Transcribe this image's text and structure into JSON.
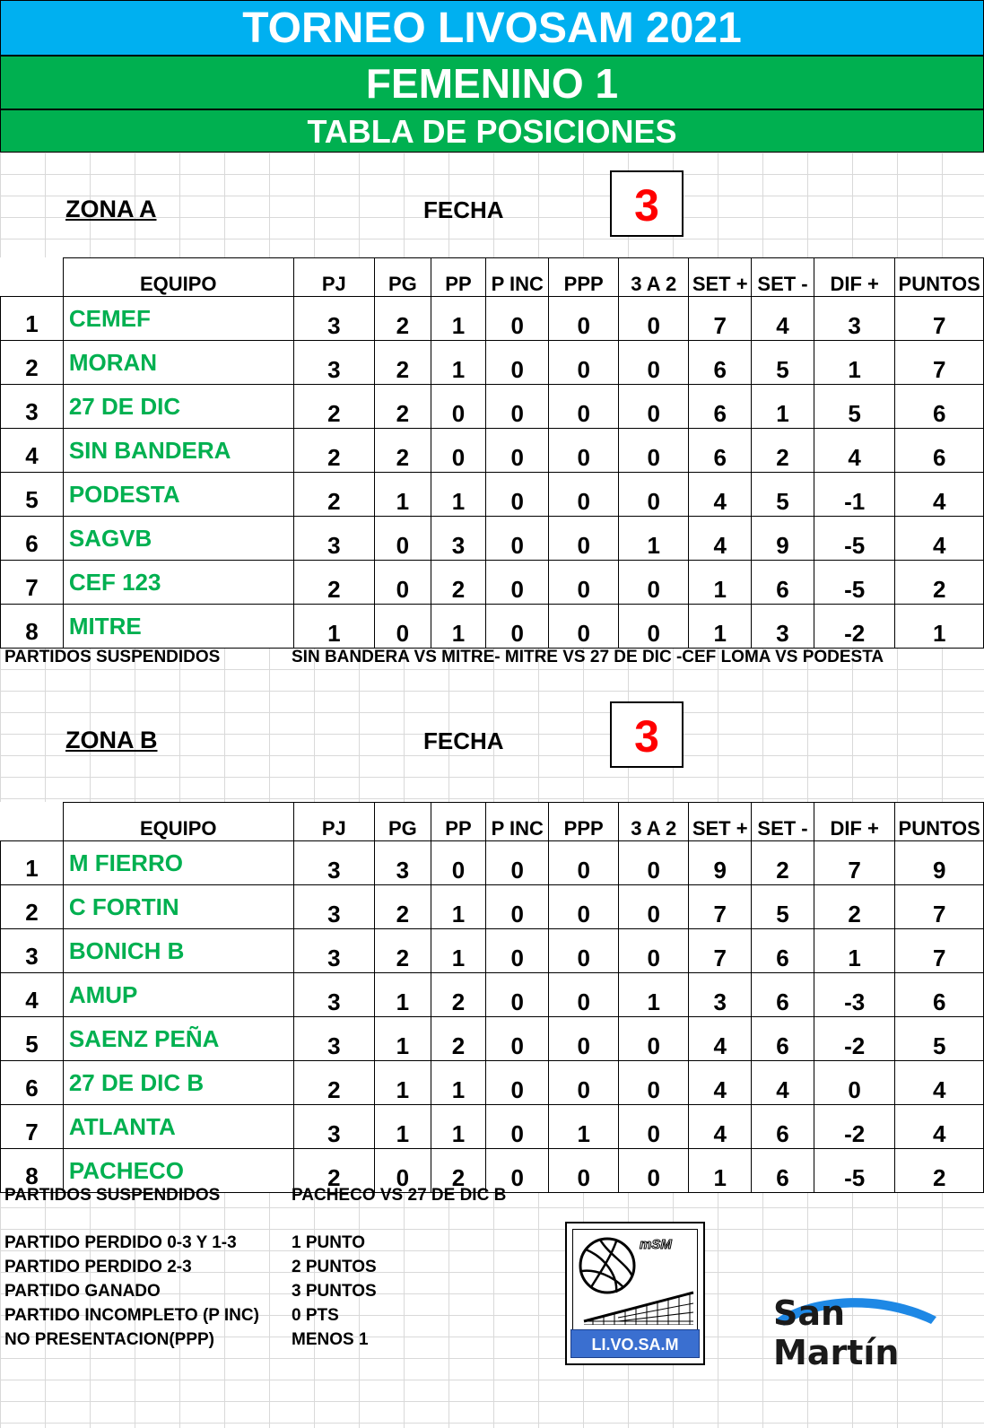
{
  "header": {
    "title": "TORNEO LIVOSAM 2021",
    "category": "FEMENINO 1",
    "subtitle": "TABLA DE POSICIONES"
  },
  "columns": [
    "EQUIPO",
    "PJ",
    "PG",
    "PP",
    "P INC",
    "PPP",
    "3 A 2",
    "SET +",
    "SET -",
    "DIF +",
    "PUNTOS"
  ],
  "fecha_label": "FECHA",
  "suspended_label": "PARTIDOS SUSPENDIDOS",
  "zones": [
    {
      "name": "ZONA A",
      "fecha": "3",
      "rows": [
        {
          "rank": "1",
          "team": "CEMEF",
          "pj": "3",
          "pg": "2",
          "pp": "1",
          "pinc": "0",
          "ppp": "0",
          "tres_a_dos": "0",
          "set_plus": "7",
          "set_minus": "4",
          "dif": "3",
          "puntos": "7"
        },
        {
          "rank": "2",
          "team": "MORAN",
          "pj": "3",
          "pg": "2",
          "pp": "1",
          "pinc": "0",
          "ppp": "0",
          "tres_a_dos": "0",
          "set_plus": "6",
          "set_minus": "5",
          "dif": "1",
          "puntos": "7"
        },
        {
          "rank": "3",
          "team": "27 DE DIC",
          "pj": "2",
          "pg": "2",
          "pp": "0",
          "pinc": "0",
          "ppp": "0",
          "tres_a_dos": "0",
          "set_plus": "6",
          "set_minus": "1",
          "dif": "5",
          "puntos": "6"
        },
        {
          "rank": "4",
          "team": "SIN BANDERA",
          "pj": "2",
          "pg": "2",
          "pp": "0",
          "pinc": "0",
          "ppp": "0",
          "tres_a_dos": "0",
          "set_plus": "6",
          "set_minus": "2",
          "dif": "4",
          "puntos": "6"
        },
        {
          "rank": "5",
          "team": "PODESTA",
          "pj": "2",
          "pg": "1",
          "pp": "1",
          "pinc": "0",
          "ppp": "0",
          "tres_a_dos": "0",
          "set_plus": "4",
          "set_minus": "5",
          "dif": "-1",
          "puntos": "4"
        },
        {
          "rank": "6",
          "team": "SAGVB",
          "pj": "3",
          "pg": "0",
          "pp": "3",
          "pinc": "0",
          "ppp": "0",
          "tres_a_dos": "1",
          "set_plus": "4",
          "set_minus": "9",
          "dif": "-5",
          "puntos": "4"
        },
        {
          "rank": "7",
          "team": "CEF 123",
          "pj": "2",
          "pg": "0",
          "pp": "2",
          "pinc": "0",
          "ppp": "0",
          "tres_a_dos": "0",
          "set_plus": "1",
          "set_minus": "6",
          "dif": "-5",
          "puntos": "2"
        },
        {
          "rank": "8",
          "team": "MITRE",
          "pj": "1",
          "pg": "0",
          "pp": "1",
          "pinc": "0",
          "ppp": "0",
          "tres_a_dos": "0",
          "set_plus": "1",
          "set_minus": "3",
          "dif": "-2",
          "puntos": "1"
        }
      ],
      "suspended": "SIN BANDERA VS MITRE- MITRE VS 27 DE DIC -CEF LOMA VS PODESTA"
    },
    {
      "name": "ZONA B",
      "fecha": "3",
      "rows": [
        {
          "rank": "1",
          "team": "M FIERRO",
          "pj": "3",
          "pg": "3",
          "pp": "0",
          "pinc": "0",
          "ppp": "0",
          "tres_a_dos": "0",
          "set_plus": "9",
          "set_minus": "2",
          "dif": "7",
          "puntos": "9"
        },
        {
          "rank": "2",
          "team": "C FORTIN",
          "pj": "3",
          "pg": "2",
          "pp": "1",
          "pinc": "0",
          "ppp": "0",
          "tres_a_dos": "0",
          "set_plus": "7",
          "set_minus": "5",
          "dif": "2",
          "puntos": "7"
        },
        {
          "rank": "3",
          "team": "BONICH B",
          "pj": "3",
          "pg": "2",
          "pp": "1",
          "pinc": "0",
          "ppp": "0",
          "tres_a_dos": "0",
          "set_plus": "7",
          "set_minus": "6",
          "dif": "1",
          "puntos": "7"
        },
        {
          "rank": "4",
          "team": "AMUP",
          "pj": "3",
          "pg": "1",
          "pp": "2",
          "pinc": "0",
          "ppp": "0",
          "tres_a_dos": "1",
          "set_plus": "3",
          "set_minus": "6",
          "dif": "-3",
          "puntos": "6"
        },
        {
          "rank": "5",
          "team": "SAENZ PEÑA",
          "pj": "3",
          "pg": "1",
          "pp": "2",
          "pinc": "0",
          "ppp": "0",
          "tres_a_dos": "0",
          "set_plus": "4",
          "set_minus": "6",
          "dif": "-2",
          "puntos": "5"
        },
        {
          "rank": "6",
          "team": "27 DE DIC B",
          "pj": "2",
          "pg": "1",
          "pp": "1",
          "pinc": "0",
          "ppp": "0",
          "tres_a_dos": "0",
          "set_plus": "4",
          "set_minus": "4",
          "dif": "0",
          "puntos": "4"
        },
        {
          "rank": "7",
          "team": "ATLANTA",
          "pj": "3",
          "pg": "1",
          "pp": "1",
          "pinc": "0",
          "ppp": "1",
          "tres_a_dos": "0",
          "set_plus": "4",
          "set_minus": "6",
          "dif": "-2",
          "puntos": "4"
        },
        {
          "rank": "8",
          "team": "PACHECO",
          "pj": "2",
          "pg": "0",
          "pp": "2",
          "pinc": "0",
          "ppp": "0",
          "tres_a_dos": "0",
          "set_plus": "1",
          "set_minus": "6",
          "dif": "-5",
          "puntos": "2"
        }
      ],
      "suspended": "PACHECO VS 27 DE DIC B"
    }
  ],
  "legend": [
    {
      "label": "PARTIDO PERDIDO 0-3 Y 1-3",
      "value": "1 PUNTO"
    },
    {
      "label": "PARTIDO PERDIDO 2-3",
      "value": "2 PUNTOS"
    },
    {
      "label": "PARTIDO GANADO",
      "value": "3 PUNTOS"
    },
    {
      "label": "PARTIDO INCOMPLETO (P INC)",
      "value": "0 PTS"
    },
    {
      "label": "NO PRESENTACION(PPP)",
      "value": "MENOS 1"
    }
  ],
  "logos": {
    "livosam_small": "mSM",
    "livosam_caption": "LI.VO.SA.M",
    "san_martin": "San Martín",
    "volleyball_icon": "volleyball-icon",
    "net_icon": "net-icon"
  },
  "colors": {
    "title_bg": "#00b0f0",
    "category_bg": "#00b050",
    "team_text": "#00b050",
    "fecha_number": "#ff0000",
    "san_martin_arc": "#1e88e5"
  }
}
